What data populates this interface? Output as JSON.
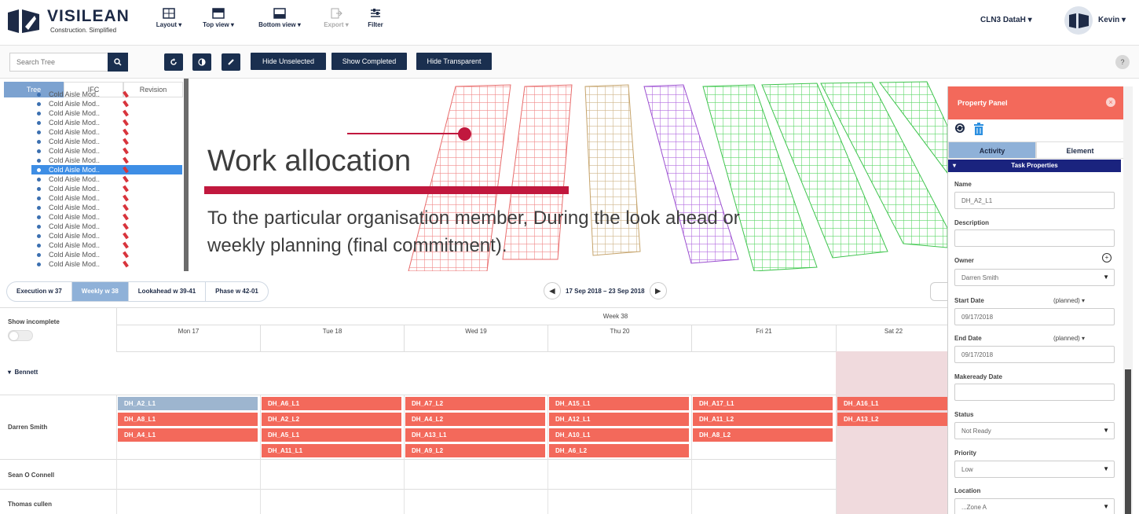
{
  "header": {
    "brand": "VISILEAN",
    "tagline": "Construction. Simplified",
    "tools": [
      {
        "label": "Layout ▾",
        "icon": "layout-icon"
      },
      {
        "label": "Top view ▾",
        "icon": "top-view-icon"
      },
      {
        "label": "Bottom view ▾",
        "icon": "bottom-view-icon"
      },
      {
        "label": "Export ▾",
        "icon": "export-icon"
      },
      {
        "label": "Filter",
        "icon": "filter-icon"
      }
    ],
    "database": "CLN3 DataH ▾",
    "user": "Kevin ▾"
  },
  "toolbar": {
    "search_placeholder": "Search Tree",
    "buttons": [
      "Hide Unselected",
      "Show Completed",
      "Hide Transparent"
    ],
    "help": "?"
  },
  "tree": {
    "tabs": [
      "Tree",
      "IFC",
      "Revision"
    ],
    "items": [
      "Cold Aisle Mod..",
      "Cold Aisle Mod..",
      "Cold Aisle Mod..",
      "Cold Aisle Mod..",
      "Cold Aisle Mod..",
      "Cold Aisle Mod..",
      "Cold Aisle Mod..",
      "Cold Aisle Mod..",
      "Cold Aisle Mod..",
      "Cold Aisle Mod..",
      "Cold Aisle Mod..",
      "Cold Aisle Mod..",
      "Cold Aisle Mod..",
      "Cold Aisle Mod..",
      "Cold Aisle Mod..",
      "Cold Aisle Mod..",
      "Cold Aisle Mod..",
      "Cold Aisle Mod..",
      "Cold Aisle Mod.."
    ]
  },
  "annotation": {
    "title": "Work allocation",
    "body": "To the particular organisation member,  During the look ahead or weekly planning (final commitment).",
    "color": "#c1183e"
  },
  "schedule": {
    "view_tabs": [
      "Execution  w 37",
      "Weekly  w 38",
      "Lookahead  w 39-41",
      "Phase  w 42-01"
    ],
    "date_range": "17 Sep 2018 – 23 Sep 2018",
    "show_incomplete": "Show incomplete",
    "week": "Week 38",
    "days": [
      "Mon 17",
      "Tue 18",
      "Wed 19",
      "Thu 20",
      "Fri 21",
      "Sat 22"
    ],
    "group": "Bennett",
    "members": [
      "Darren Smith",
      "Sean O Connell",
      "Thomas cullen"
    ],
    "tasks": [
      [
        "DH_A2_L1",
        "DH_A8_L1",
        "DH_A4_L1"
      ],
      [
        "DH_A6_L1",
        "DH_A2_L2",
        "DH_A5_L1",
        "DH_A11_L1"
      ],
      [
        "DH_A7_L2",
        "DH_A4_L2",
        "DH_A13_L1",
        "DH_A9_L2"
      ],
      [
        "DH_A15_L1",
        "DH_A12_L1",
        "DH_A10_L1",
        "DH_A6_L2"
      ],
      [
        "DH_A17_L1",
        "DH_A11_L2",
        "DH_A8_L2"
      ],
      [
        "DH_A16_L1",
        "DH_A13_L2"
      ]
    ],
    "task_color": "#f3695b",
    "selected_task_color": "#9db5cf"
  },
  "property_panel": {
    "title": "Property Panel",
    "tabs": [
      "Activity",
      "Element"
    ],
    "section": "Task Properties",
    "name_label": "Name",
    "name_value": "DH_A2_L1",
    "description_label": "Description",
    "owner_label": "Owner",
    "owner_value": "Darren Smith",
    "start_label": "Start Date",
    "start_sub": "(planned) ▾",
    "start_value": "09/17/2018",
    "end_label": "End Date",
    "end_sub": "(planned) ▾",
    "end_value": "09/17/2018",
    "makeready_label": "Makeready Date",
    "status_label": "Status",
    "status_value": "Not Ready",
    "priority_label": "Priority",
    "priority_value": "Low",
    "location_label": "Location",
    "location_value": "...Zone A"
  }
}
